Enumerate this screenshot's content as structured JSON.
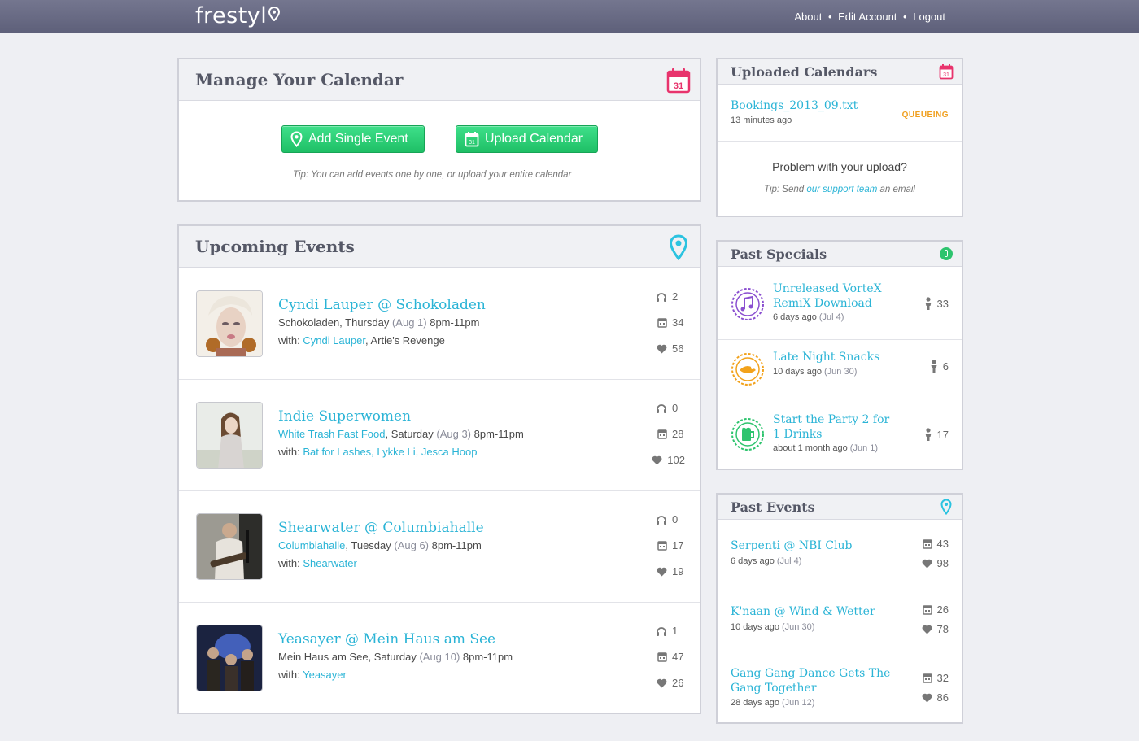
{
  "brand": {
    "name": "frestyl"
  },
  "nav": {
    "about": "About",
    "edit_account": "Edit Account",
    "logout": "Logout",
    "separator": "•"
  },
  "manage": {
    "title": "Manage Your Calendar",
    "add_single": "Add Single Event",
    "upload": "Upload Calendar",
    "tip_label": "Tip:",
    "tip_text": "You can add events one by one, or upload your entire calendar"
  },
  "upcoming": {
    "title": "Upcoming Events",
    "events": [
      {
        "title": "Cyndi Lauper @ Schokoladen",
        "venue": "Schokoladen",
        "day": ", Thursday ",
        "date": "(Aug 1)",
        "time": " 8pm-11pm",
        "with_label": "with: ",
        "artists_linked": "Cyndi Lauper",
        "artists_rest": ", Artie's Revenge",
        "listens": "2",
        "calendar": "34",
        "likes": "56"
      },
      {
        "title": "Indie Superwomen",
        "venue": "White Trash Fast Food",
        "day": ", Saturday ",
        "date": "(Aug 3)",
        "time": " 8pm-11pm",
        "with_label": "with: ",
        "artists_linked": "Bat for Lashes, Lykke Li, Jesca Hoop",
        "artists_rest": "",
        "listens": "0",
        "calendar": "28",
        "likes": "102"
      },
      {
        "title": "Shearwater @ Columbiahalle",
        "venue": "Columbiahalle",
        "day": ", Tuesday ",
        "date": "(Aug 6)",
        "time": " 8pm-11pm",
        "with_label": "with: ",
        "artists_linked": "Shearwater",
        "artists_rest": "",
        "listens": "0",
        "calendar": "17",
        "likes": "19"
      },
      {
        "title": "Yeasayer @ Mein Haus am See",
        "venue": "Mein Haus am See",
        "day": ", Saturday ",
        "date": "(Aug 10)",
        "time": " 8pm-11pm",
        "with_label": "with: ",
        "artists_linked": "Yeasayer",
        "artists_rest": "",
        "listens": "1",
        "calendar": "47",
        "likes": "26"
      }
    ]
  },
  "uploaded": {
    "title": "Uploaded Calendars",
    "file": "Bookings_2013_09.txt",
    "ago": "13 minutes ago",
    "status": "QUEUEING",
    "problem": "Problem with your upload?",
    "tip_label": "Tip:",
    "tip_pre": " Send ",
    "tip_link": "our support team",
    "tip_post": " an email"
  },
  "specials": {
    "title": "Past Specials",
    "items": [
      {
        "title": "Unreleased VorteX RemiX Download",
        "ago": "6 days ago ",
        "date": "(Jul 4)",
        "count": "33",
        "icon": "music-note-icon",
        "color": "#8a4fd0"
      },
      {
        "title": "Late Night Snacks",
        "ago": "10 days ago ",
        "date": "(Jun 30)",
        "count": "6",
        "icon": "snack-icon",
        "color": "#f2a21c"
      },
      {
        "title": "Start the Party 2 for 1 Drinks",
        "ago": "about 1 month ago ",
        "date": "(Jun 1)",
        "count": "17",
        "icon": "beer-icon",
        "color": "#2ec46e"
      }
    ]
  },
  "pastevents": {
    "title": "Past Events",
    "items": [
      {
        "title": "Serpenti @ NBI Club",
        "ago": "6 days ago ",
        "date": "(Jul 4)",
        "calendar": "43",
        "likes": "98"
      },
      {
        "title": "K'naan @ Wind & Wetter",
        "ago": "10 days ago ",
        "date": "(Jun 30)",
        "calendar": "26",
        "likes": "78"
      },
      {
        "title": "Gang Gang Dance Gets The Gang Together",
        "ago": "28 days ago ",
        "date": "(Jun 12)",
        "calendar": "32",
        "likes": "86"
      }
    ]
  },
  "colors": {
    "accent": "#2bb4d6",
    "green": "#25c96e",
    "topbar": "#6a6c86",
    "calendar_red": "#e8336c"
  },
  "calendar_icon_day": "31"
}
